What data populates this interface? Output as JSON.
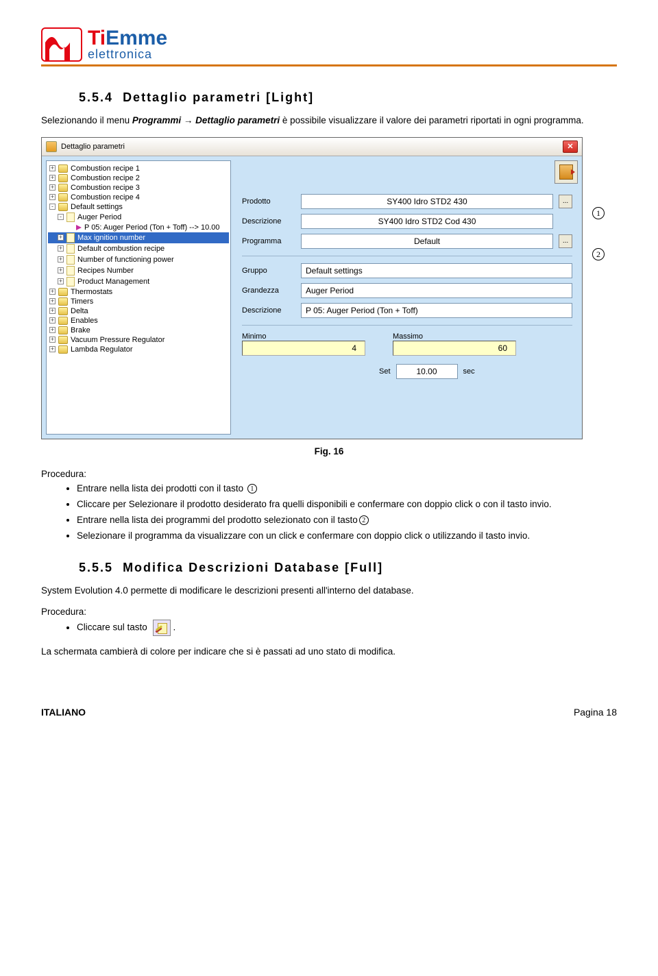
{
  "logo": {
    "main1": "Ti",
    "main2": "Emme",
    "sub": "elettronica"
  },
  "section1": {
    "number": "5.5.4",
    "title": "Dettaglio parametri [Light]",
    "intro_pre": "Selezionando il menu ",
    "intro_em": "Programmi → Dettaglio parametri",
    "intro_post": " è possibile visualizzare il valore dei parametri riportati in ogni programma."
  },
  "screenshot": {
    "title": "Dettaglio parametri",
    "tree": {
      "items": [
        {
          "pm": "+",
          "icon": "folder",
          "label": "Combustion recipe 1",
          "ind": 0
        },
        {
          "pm": "+",
          "icon": "folder",
          "label": "Combustion recipe 2",
          "ind": 0
        },
        {
          "pm": "+",
          "icon": "folder",
          "label": "Combustion recipe 3",
          "ind": 0
        },
        {
          "pm": "+",
          "icon": "folder",
          "label": "Combustion recipe 4",
          "ind": 0
        },
        {
          "pm": "-",
          "icon": "folder",
          "label": "Default settings",
          "ind": 0
        },
        {
          "pm": "-",
          "icon": "note",
          "label": "Auger Period",
          "ind": 1
        },
        {
          "pm": "",
          "icon": "arrow",
          "label": "P 05: Auger Period (Ton + Toff) --> 10.00",
          "ind": 2
        },
        {
          "pm": "+",
          "icon": "note",
          "label": "Max ignition number",
          "ind": 1,
          "sel": true
        },
        {
          "pm": "+",
          "icon": "note",
          "label": "Default combustion recipe",
          "ind": 1
        },
        {
          "pm": "+",
          "icon": "note",
          "label": "Number of functioning power",
          "ind": 1
        },
        {
          "pm": "+",
          "icon": "note",
          "label": "Recipes Number",
          "ind": 1
        },
        {
          "pm": "+",
          "icon": "note",
          "label": "Product Management",
          "ind": 1
        },
        {
          "pm": "+",
          "icon": "folder",
          "label": "Thermostats",
          "ind": 0
        },
        {
          "pm": "+",
          "icon": "folder",
          "label": "Timers",
          "ind": 0
        },
        {
          "pm": "+",
          "icon": "folder",
          "label": "Delta",
          "ind": 0
        },
        {
          "pm": "+",
          "icon": "folder",
          "label": "Enables",
          "ind": 0
        },
        {
          "pm": "+",
          "icon": "folder",
          "label": "Brake",
          "ind": 0
        },
        {
          "pm": "+",
          "icon": "folder",
          "label": "Vacuum Pressure Regulator",
          "ind": 0
        },
        {
          "pm": "+",
          "icon": "folder",
          "label": "Lambda Regulator",
          "ind": 0
        }
      ]
    },
    "form": {
      "prodotto_label": "Prodotto",
      "prodotto_value": "SY400 Idro STD2 430",
      "descr_label": "Descrizione",
      "descr_value": "SY400 Idro STD2 Cod 430",
      "prog_label": "Programma",
      "prog_value": "Default",
      "gruppo_label": "Gruppo",
      "gruppo_value": "Default settings",
      "grand_label": "Grandezza",
      "grand_value": "Auger Period",
      "descr2_label": "Descrizione",
      "descr2_value": "P 05: Auger Period (Ton + Toff)",
      "min_label": "Minimo",
      "min_value": "4",
      "max_label": "Massimo",
      "max_value": "60",
      "set_label": "Set",
      "set_value": "10.00",
      "set_unit": "sec"
    }
  },
  "markers": {
    "m1": "1",
    "m2": "2"
  },
  "figcap": "Fig. 16",
  "procedure": {
    "head": "Procedura:",
    "b1_a": "Entrare nella lista dei prodotti con il tasto ",
    "b1_n": "1",
    "b2": "Cliccare per Selezionare il prodotto desiderato fra quelli disponibili e confermare con doppio click o con il tasto invio.",
    "b3_a": "Entrare nella lista dei programmi del prodotto selezionato con il tasto",
    "b3_n": "2",
    "b4": "Selezionare il programma da visualizzare con un click e confermare con doppio click o utilizzando il tasto invio."
  },
  "section2": {
    "number": "5.5.5",
    "title": "Modifica Descrizioni Database [Full]",
    "line1": "System Evolution 4.0 permette di modificare le descrizioni presenti all'interno del database.",
    "proc_head": "Procedura:",
    "bullet_a": "Cliccare sul tasto ",
    "bullet_b": ".",
    "line2": "La schermata cambierà di colore per indicare che si è passati ad uno stato di modifica."
  },
  "footer": {
    "left": "ITALIANO",
    "right": "Pagina 18"
  }
}
